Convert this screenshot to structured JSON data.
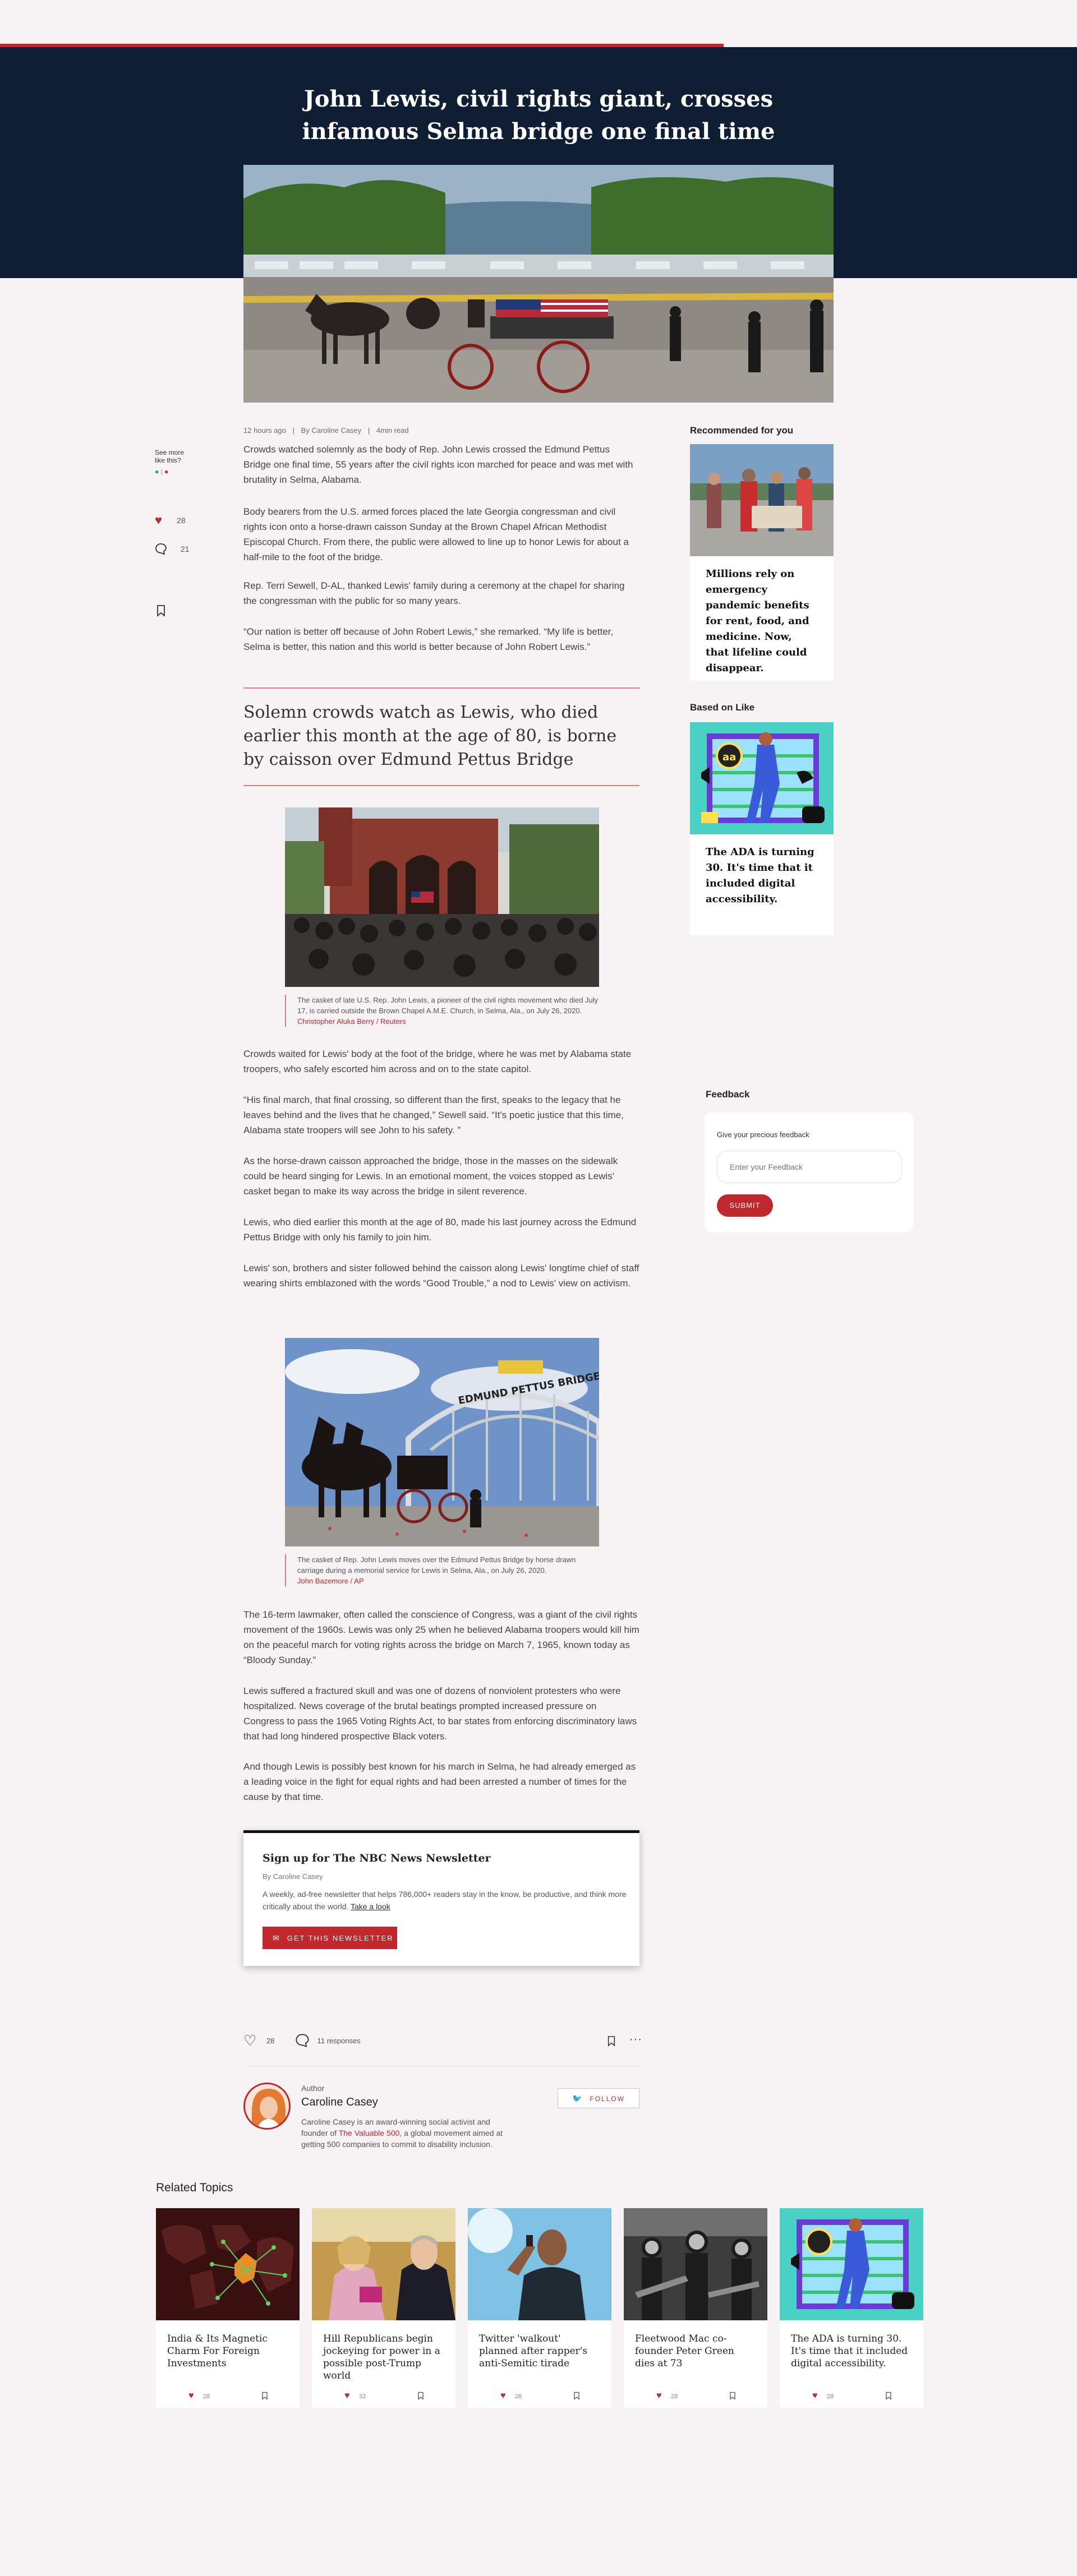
{
  "reading_progress": 0.7,
  "colors": {
    "accent": "#c0282d",
    "hero_bg": "#0f1e33",
    "page_bg": "#f7f2f3"
  },
  "article": {
    "title": "John Lewis, civil rights giant, crosses infamous Selma bridge one final time",
    "time_ago": "12 hours ago",
    "byline": "By Caroline Casey",
    "read_time": "4min read",
    "paragraphs_1": [
      "Crowds watched solemnly as the body of Rep. John Lewis crossed the Edmund Pettus Bridge one final time, 55 years after the civil rights icon marched for peace and was met with brutality in Selma, Alabama.",
      "Body bearers from the U.S. armed forces placed the late Georgia congressman and civil rights icon onto a horse-drawn caisson Sunday at the Brown Chapel African Methodist Episcopal Church. From there, the public were allowed to line up to honor Lewis for about a half-mile to the foot of the bridge.",
      "Rep. Terri Sewell, D-AL, thanked Lewis' family during a ceremony at the chapel for sharing the congressman with the public for so many years.",
      "“Our nation is better off because of John Robert Lewis,” she remarked. “My life is better, Selma is better, this nation and this world is better because of John Robert Lewis.”"
    ],
    "pullquote": "Solemn crowds watch as Lewis, who died earlier this month at the age of 80, is borne by caisson over Edmund Pettus Bridge",
    "figure_1": {
      "caption": "The casket of late U.S. Rep. John Lewis, a pioneer of the civil rights movement who died July 17, is carried outside the Brown Chapel A.M.E. Church, in Selma, Ala., on July 26, 2020.",
      "credit": "Christopher Aluka Berry / Reuters"
    },
    "paragraphs_2": [
      "Crowds waited for Lewis' body at the foot of the bridge, where he was met by Alabama state troopers, who safely escorted him across and on to the state capitol.",
      "“His final march, that final crossing, so different than the first, speaks to the legacy that he leaves behind and the lives that he changed,” Sewell said. “It's poetic justice that this time, Alabama state troopers will see John to his safety. ”",
      "As the horse-drawn caisson approached the bridge, those in the masses on the sidewalk could be heard singing for Lewis. In an emotional moment, the voices stopped as Lewis' casket began to make its way across the bridge in silent reverence.",
      "Lewis, who died earlier this month at the age of 80, made his last journey across the Edmund Pettus Bridge with only his family to join him.",
      "Lewis' son, brothers and sister followed behind the caisson along Lewis' longtime chief of staff wearing shirts emblazoned with the words “Good Trouble,” a nod to Lewis' view on activism."
    ],
    "figure_2": {
      "caption": "The casket of Rep. John Lewis moves over the Edmund Pettus Bridge by horse drawn carriage during a memorial service for Lewis in Selma, Ala., on July 26, 2020.",
      "credit": "John Bazemore / AP",
      "sign_text": "EDMUND PETTUS BRIDGE"
    },
    "paragraphs_3": [
      "The 16-term lawmaker, often called the conscience of Congress, was a giant of the civil rights movement of the 1960s. Lewis was only 25 when he believed Alabama troopers would kill him on the peaceful march for voting rights across the bridge on March 7, 1965, known today as “Bloody Sunday.”",
      "Lewis suffered a fractured skull and was one of dozens of nonviolent protesters who were hospitalized. News coverage of the brutal beatings prompted increased pressure on Congress to pass the 1965 Voting Rights Act, to bar states from enforcing discriminatory laws that had long hindered prospective Black voters.",
      "And though Lewis is possibly best known for his march in Selma, he had already emerged as a leading voice in the fight for equal rights and had been arrested a number of times for the cause by that time."
    ]
  },
  "side_actions": {
    "see_more_line1": "See more",
    "see_more_line2": "like this?",
    "likes": "28",
    "comments": "21"
  },
  "recommended": {
    "heading": "Recommended for you",
    "card_text": "Millions rely on emergency pandemic benefits for rent, food, and medicine. Now, that lifeline could disappear."
  },
  "based_on_like": {
    "heading": "Based on Like",
    "card_text": "The ADA is turning 30. It's time that it included digital accessibility."
  },
  "feedback": {
    "heading": "Feedback",
    "label": "Give your precious feedback",
    "placeholder": "Enter your Feedback",
    "submit": "SUBMIT"
  },
  "newsletter": {
    "title": "Sign up for The NBC News Newsletter",
    "byline": "By Caroline Casey",
    "description": "A weekly, ad-free newsletter that helps 786,000+ readers stay in the know, be productive, and think more critically about the world.",
    "link": "Take a look",
    "button": "GET THIS NEWSLETTER"
  },
  "footer_actions": {
    "likes": "28",
    "responses": "11 responses"
  },
  "author": {
    "label": "Author",
    "name": "Caroline Casey",
    "bio_before": "Caroline Casey is an award-winning social activist and founder of ",
    "bio_link": "The Valuable 500",
    "bio_after": ", a global movement aimed at getting 500 companies to commit to disability inclusion.",
    "follow": "FOLLOW"
  },
  "related": {
    "heading": "Related Topics",
    "cards": [
      {
        "title": "India & Its Magnetic Charm For Foreign Investments",
        "likes": "28"
      },
      {
        "title": "Hill Republicans begin jockeying for power in a possible post-Trump world",
        "likes": "32"
      },
      {
        "title": "Twitter 'walkout' planned after rapper's anti-Semitic tirade",
        "likes": "28"
      },
      {
        "title": "Fleetwood Mac co-founder Peter Green dies at 73",
        "likes": "28"
      },
      {
        "title": "The ADA is turning 30. It's time that it included digital accessibility.",
        "likes": "28"
      }
    ]
  }
}
